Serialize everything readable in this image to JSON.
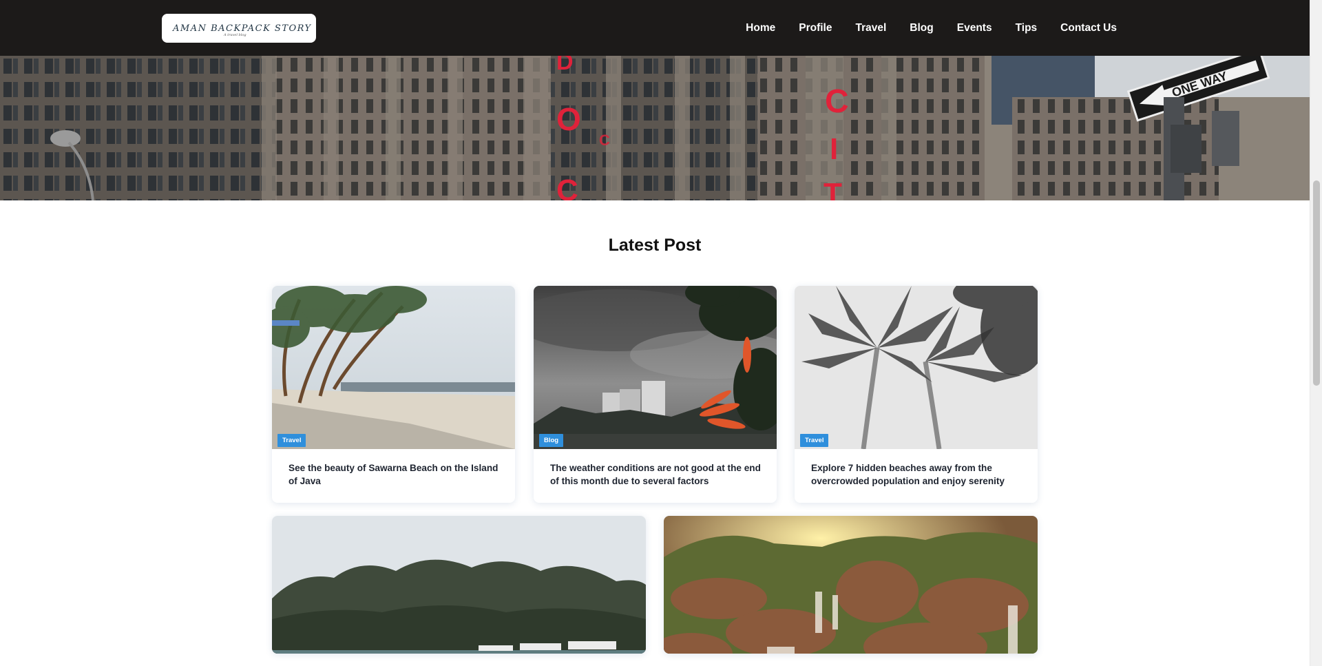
{
  "header": {
    "logo_text": "AMAN BACKPACK STORY",
    "logo_subtext": "A travel blog",
    "nav": [
      "Home",
      "Profile",
      "Travel",
      "Blog",
      "Events",
      "Tips",
      "Contact Us"
    ]
  },
  "hero": {
    "sign_text": "ONE WAY"
  },
  "section": {
    "title": "Latest Post"
  },
  "posts": [
    {
      "tag": "Travel",
      "title": "See the beauty of Sawarna Beach on the Island of Java"
    },
    {
      "tag": "Blog",
      "title": "The weather conditions are not good at the end of this month due to several factors"
    },
    {
      "tag": "Travel",
      "title": "Explore 7 hidden beaches away from the overcrowded population and enjoy serenity"
    }
  ],
  "colors": {
    "header_bg": "#1c1a19",
    "tag_bg": "#2f8fdc",
    "title_text": "#1e2430"
  }
}
